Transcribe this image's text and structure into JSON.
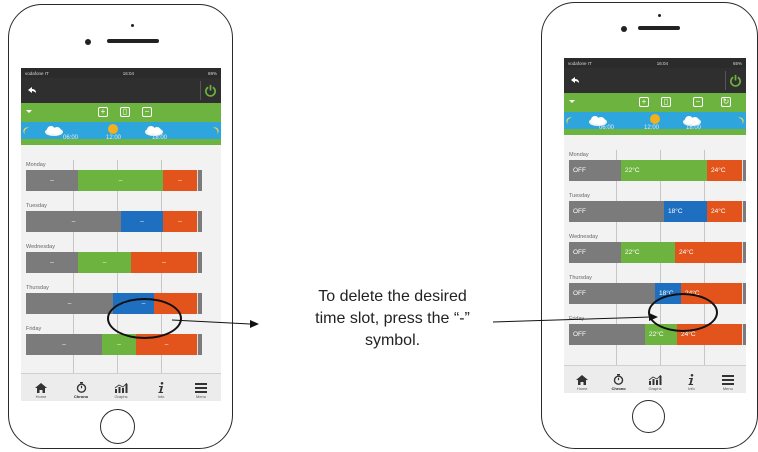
{
  "instruction": {
    "line1": "To delete the desired",
    "line2": "time slot, press the “-”",
    "line3": "symbol."
  },
  "left_phone": {
    "status": {
      "carrier": "vodafone IT",
      "time": "16:04",
      "battery": "69%"
    },
    "toolbar_buttons": [
      "+",
      "▯",
      "−"
    ],
    "timeline": [
      "06:00",
      "12:00",
      "18:00"
    ],
    "days": [
      {
        "label": "Monday",
        "segments": [
          {
            "color": "gray",
            "text": "–",
            "w": 52
          },
          {
            "color": "green",
            "text": "–",
            "w": 85
          },
          {
            "color": "orange",
            "text": "–",
            "w": 34
          }
        ]
      },
      {
        "label": "Tuesday",
        "segments": [
          {
            "color": "gray",
            "text": "–",
            "w": 95
          },
          {
            "color": "blue",
            "text": "–",
            "w": 42
          },
          {
            "color": "orange",
            "text": "–",
            "w": 34
          }
        ]
      },
      {
        "label": "Wednesday",
        "segments": [
          {
            "color": "gray",
            "text": "–",
            "w": 52
          },
          {
            "color": "green",
            "text": "–",
            "w": 53
          },
          {
            "color": "orange",
            "text": "–",
            "w": 66
          }
        ]
      },
      {
        "label": "Thursday",
        "segments": [
          {
            "color": "gray",
            "text": "–",
            "w": 87
          },
          {
            "color": "blue",
            "text": "–",
            "w": 20
          },
          {
            "color": "blue",
            "text": "–",
            "w": 21
          },
          {
            "color": "orange",
            "text": "",
            "w": 43
          }
        ]
      },
      {
        "label": "Friday",
        "segments": [
          {
            "color": "gray",
            "text": "–",
            "w": 76
          },
          {
            "color": "green",
            "text": "–",
            "w": 34
          },
          {
            "color": "orange",
            "text": "–",
            "w": 61
          }
        ]
      }
    ],
    "nav": [
      "Home",
      "Chrono",
      "Graphs",
      "Info",
      "Menu"
    ]
  },
  "right_phone": {
    "status": {
      "carrier": "vodafone IT",
      "time": "16:04",
      "battery": "65%"
    },
    "toolbar_buttons": [
      "+",
      "▯",
      "−",
      "↻"
    ],
    "timeline": [
      "06:00",
      "12:00",
      "18:00"
    ],
    "days": [
      {
        "label": "Monday",
        "segments": [
          {
            "color": "gray",
            "text": "OFF",
            "w": 52
          },
          {
            "color": "green",
            "text": "22°C",
            "w": 86
          },
          {
            "color": "orange",
            "text": "24°C",
            "w": 35
          }
        ]
      },
      {
        "label": "Tuesday",
        "segments": [
          {
            "color": "gray",
            "text": "OFF",
            "w": 95
          },
          {
            "color": "blue",
            "text": "18°C",
            "w": 43
          },
          {
            "color": "orange",
            "text": "24°C",
            "w": 35
          }
        ]
      },
      {
        "label": "Wednesday",
        "segments": [
          {
            "color": "gray",
            "text": "OFF",
            "w": 52
          },
          {
            "color": "green",
            "text": "22°C",
            "w": 54
          },
          {
            "color": "orange",
            "text": "24°C",
            "w": 67
          }
        ]
      },
      {
        "label": "Thursday",
        "segments": [
          {
            "color": "gray",
            "text": "OFF",
            "w": 86
          },
          {
            "color": "blue",
            "text": "18°C",
            "w": 26
          },
          {
            "color": "orange",
            "text": "24°C",
            "w": 61
          }
        ]
      },
      {
        "label": "Friday",
        "segments": [
          {
            "color": "gray",
            "text": "OFF",
            "w": 76
          },
          {
            "color": "green",
            "text": "22°C",
            "w": 32
          },
          {
            "color": "orange",
            "text": "24°C",
            "w": 65
          }
        ]
      }
    ],
    "nav": [
      "Home",
      "Chrono",
      "Graphs",
      "Info",
      "Menu"
    ]
  }
}
